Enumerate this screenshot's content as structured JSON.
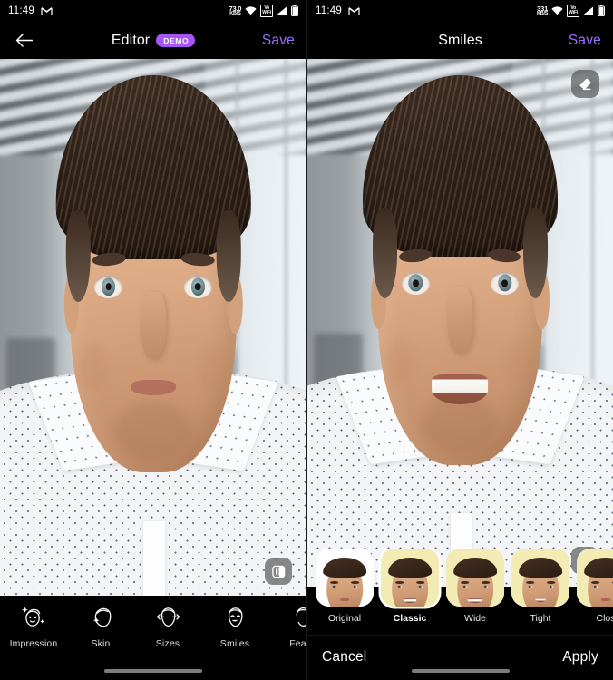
{
  "left_screen": {
    "status_bar": {
      "time": "11:49",
      "gmail_icon": "gmail-icon",
      "network_speed_value": "73.0",
      "network_speed_unit": "KB/S",
      "wifi_icon": "wifi-icon",
      "vowifi_label_top": "Vo",
      "vowifi_label_bottom": "WiFi",
      "signal_icon": "cellular-signal-icon",
      "battery_icon": "battery-icon"
    },
    "header": {
      "back_icon": "back-arrow-icon",
      "title": "Editor",
      "badge": "DEMO",
      "save_label": "Save",
      "save_color": "#9b6dff",
      "badge_color": "#a855f7"
    },
    "photo": {
      "compare_icon": "before-after-compare-icon"
    },
    "toolbar": {
      "items": [
        {
          "label": "Impression",
          "icon": "face-sparkle-icon"
        },
        {
          "label": "Skin",
          "icon": "face-skin-icon"
        },
        {
          "label": "Sizes",
          "icon": "face-resize-icon"
        },
        {
          "label": "Smiles",
          "icon": "face-smile-icon"
        },
        {
          "label": "Featu",
          "icon": "face-features-icon"
        }
      ]
    }
  },
  "right_screen": {
    "status_bar": {
      "time": "11:49",
      "gmail_icon": "gmail-icon",
      "network_speed_value": "331",
      "network_speed_unit": "KB/S",
      "wifi_icon": "wifi-icon",
      "vowifi_label_top": "Vo",
      "vowifi_label_bottom": "WiFi",
      "signal_icon": "cellular-signal-icon",
      "battery_icon": "battery-icon"
    },
    "header": {
      "title": "Smiles",
      "save_label": "Save",
      "save_color": "#9b6dff"
    },
    "photo": {
      "eraser_icon": "eraser-icon",
      "compare_icon": "before-after-compare-icon"
    },
    "smile_styles": {
      "selected": "Classic",
      "items": [
        {
          "label": "Original",
          "style": "original"
        },
        {
          "label": "Classic",
          "style": "classic"
        },
        {
          "label": "Wide",
          "style": "wide"
        },
        {
          "label": "Tight",
          "style": "tight"
        },
        {
          "label": "Clos",
          "style": "closed"
        }
      ]
    },
    "actions": {
      "cancel_label": "Cancel",
      "apply_label": "Apply"
    }
  }
}
